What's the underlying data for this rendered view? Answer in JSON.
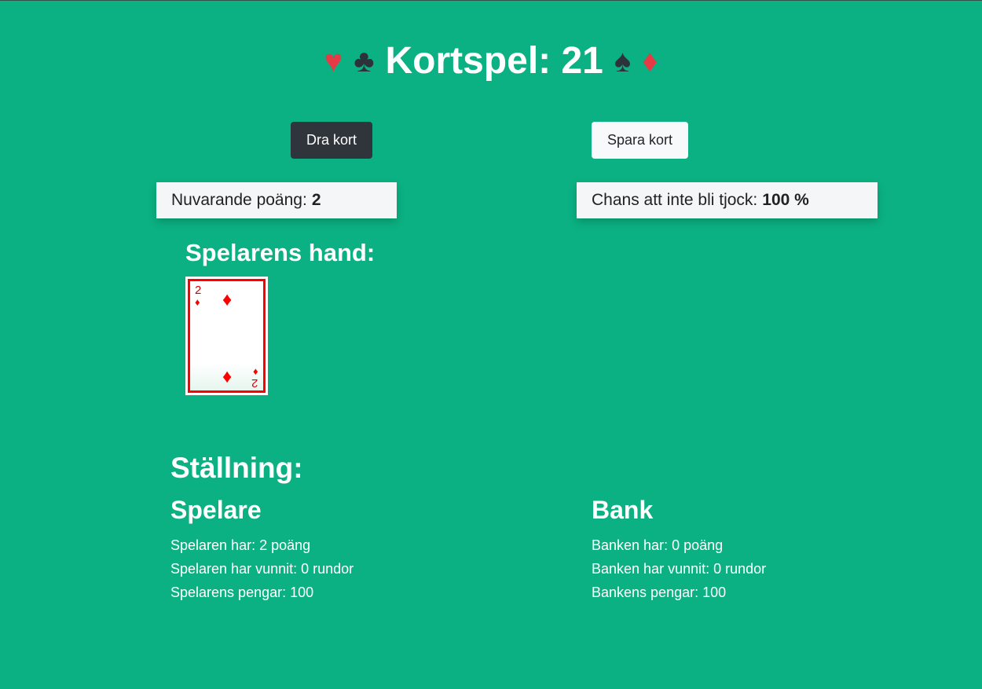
{
  "header": {
    "title": "Kortspel: 21",
    "suits_left": [
      "♥",
      "♣"
    ],
    "suits_right": [
      "♠",
      "♦"
    ]
  },
  "actions": {
    "draw_label": "Dra kort",
    "stand_label": "Spara kort"
  },
  "status": {
    "points_label": "Nuvarande poäng:",
    "points_value": "2",
    "chance_label": "Chans att inte bli tjock:",
    "chance_value": "100 %"
  },
  "hand": {
    "title": "Spelarens hand:",
    "cards": [
      {
        "rank": "2",
        "suit": "♦",
        "color": "#ff0000"
      }
    ]
  },
  "scoreboard": {
    "title": "Ställning:",
    "player": {
      "title": "Spelare",
      "points": "Spelaren har: 2 poäng",
      "wins": "Spelaren har vunnit: 0 rundor",
      "money": "Spelarens pengar: 100"
    },
    "bank": {
      "title": "Bank",
      "points": "Banken har: 0 poäng",
      "wins": "Banken har vunnit: 0 rundor",
      "money": "Bankens pengar: 100"
    }
  },
  "colors": {
    "table_green": "#0bb182",
    "suit_red": "#e63a46",
    "suit_dark": "#2d333a",
    "button_dark": "#2f353b",
    "card_red": "#ff0000"
  }
}
